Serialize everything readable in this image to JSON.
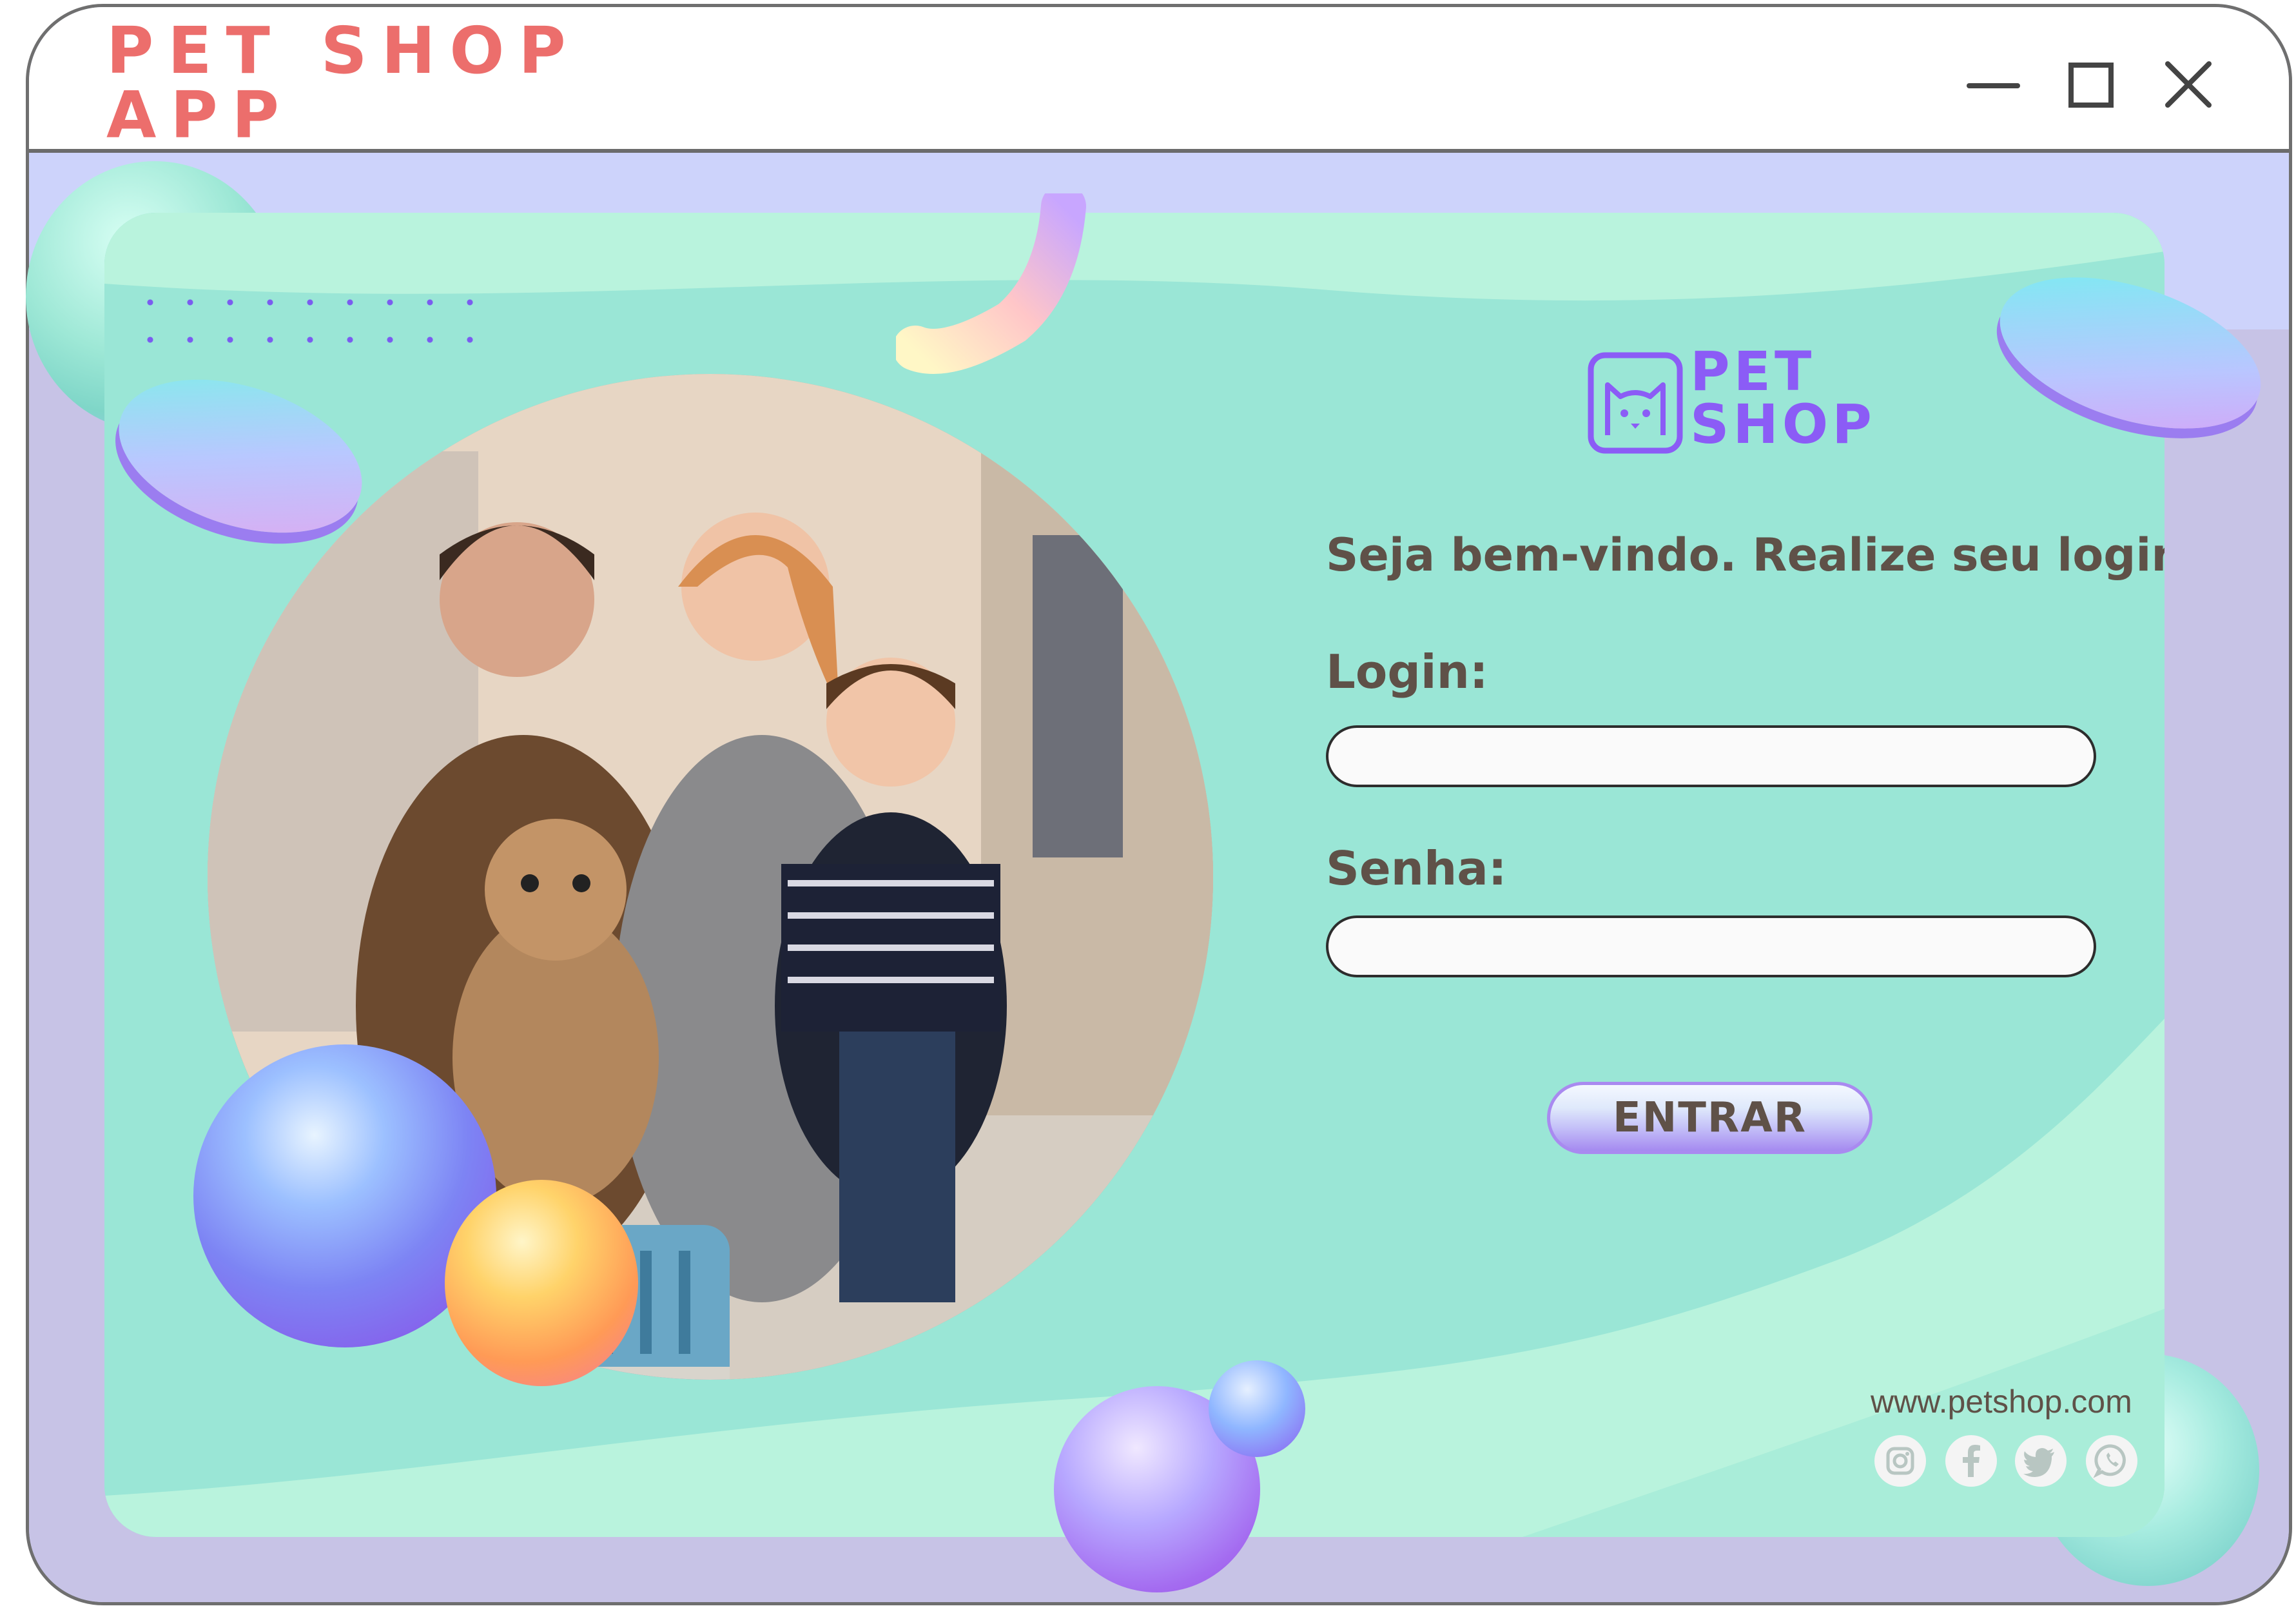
{
  "window": {
    "app_title": "PET SHOP APP",
    "controls": {
      "minimize_icon": "minimize-icon",
      "maximize_icon": "maximize-icon",
      "close_icon": "close-icon"
    }
  },
  "brand": {
    "line1": "PET",
    "line2": "SHOP",
    "icon": "cat-face-icon"
  },
  "login_form": {
    "welcome": "Seja bem-vindo. Realize seu login:",
    "login_label": "Login:",
    "login_value": "",
    "password_label": "Senha:",
    "password_value": "",
    "submit_label": "ENTRAR"
  },
  "footer": {
    "website": "www.petshop.com",
    "social": [
      "instagram-icon",
      "facebook-icon",
      "twitter-icon",
      "whatsapp-icon"
    ]
  },
  "colors": {
    "title": "#ec6e6c",
    "brand": "#8b5cf6",
    "text": "#5f5148",
    "card": "#9ae6d6",
    "frame": "#cdd3fb"
  }
}
